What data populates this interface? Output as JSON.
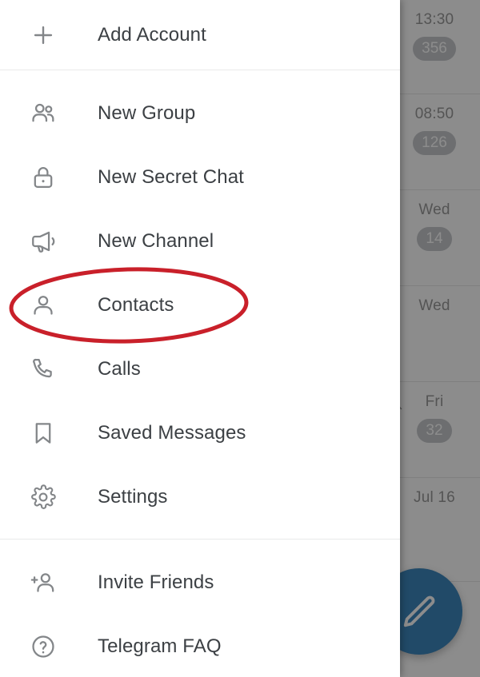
{
  "app": {
    "name": "Telegram",
    "screen": "navigation-drawer"
  },
  "colors": {
    "accent": "#3c87bd",
    "annotation": "#c9202a",
    "text": "#3c4044",
    "icon": "#838689",
    "divider": "#e9eaea",
    "badge": "#c6c9cc",
    "scrim": "rgba(0,0,0,0.45)"
  },
  "drawer": {
    "sections": [
      {
        "id": "account",
        "items": [
          {
            "label": "Add Account",
            "icon": "plus-icon",
            "name": "add-account"
          }
        ]
      },
      {
        "id": "primary",
        "items": [
          {
            "label": "New Group",
            "icon": "group-icon",
            "name": "new-group"
          },
          {
            "label": "New Secret Chat",
            "icon": "lock-icon",
            "name": "new-secret-chat"
          },
          {
            "label": "New Channel",
            "icon": "megaphone-icon",
            "name": "new-channel"
          },
          {
            "label": "Contacts",
            "icon": "person-icon",
            "name": "contacts"
          },
          {
            "label": "Calls",
            "icon": "phone-icon",
            "name": "calls"
          },
          {
            "label": "Saved Messages",
            "icon": "bookmark-icon",
            "name": "saved-messages"
          },
          {
            "label": "Settings",
            "icon": "gear-icon",
            "name": "settings"
          }
        ]
      },
      {
        "id": "secondary",
        "items": [
          {
            "label": "Invite Friends",
            "icon": "person-add-icon",
            "name": "invite-friends"
          },
          {
            "label": "Telegram FAQ",
            "icon": "question-circle-icon",
            "name": "telegram-faq"
          }
        ]
      }
    ]
  },
  "annotation": {
    "type": "ellipse",
    "target": "Contacts",
    "color": "#c9202a"
  },
  "chat_list": {
    "rows": [
      {
        "time": "13:30",
        "badge": "356",
        "muted": false
      },
      {
        "time": "08:50",
        "badge": "126",
        "muted": false
      },
      {
        "time": "Wed",
        "badge": "14",
        "muted": false
      },
      {
        "time": "Wed",
        "badge": "",
        "muted": false
      },
      {
        "time": "Fri",
        "badge": "32",
        "muted": true
      },
      {
        "time": "Jul 16",
        "badge": "",
        "muted": false
      }
    ],
    "compose_button": {
      "name": "compose-fab",
      "icon": "pencil-icon"
    }
  }
}
